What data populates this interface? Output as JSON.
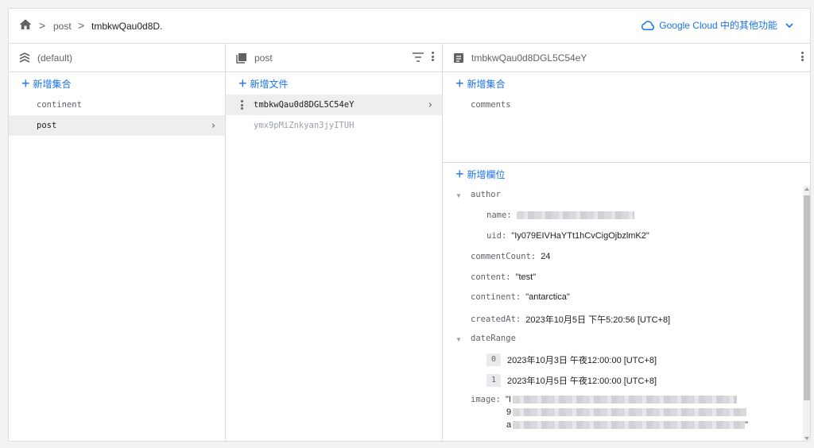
{
  "breadcrumb": {
    "items": [
      "post",
      "tmbkwQau0d8D."
    ],
    "separator": ">"
  },
  "gcloud": {
    "label": "Google Cloud 中的其他功能"
  },
  "columns": {
    "root": {
      "title": "(default)",
      "add_label": "新增集合",
      "items": [
        "continent",
        "post"
      ],
      "selected": "post"
    },
    "collection": {
      "title": "post",
      "add_label": "新增文件",
      "docs": [
        "tmbkwQau0d8DGL5C54eY",
        "ymx9pMiZnkyan3jyITUH"
      ]
    },
    "document": {
      "title": "tmbkwQau0d8DGL5C54eY",
      "add_collection_label": "新增集合",
      "subcollections": [
        "comments"
      ],
      "add_field_label": "新增欄位",
      "fields": {
        "author_key": "author",
        "name_key": "name:",
        "uid_key": "uid:",
        "uid_val": "\"Iy079EIVHaYTt1hCvCigOjbzlmK2\"",
        "commentCount_key": "commentCount:",
        "commentCount_val": "24",
        "content_key": "content:",
        "content_val": "\"test\"",
        "continent_key": "continent:",
        "continent_val": "\"antarctica\"",
        "createdAt_key": "createdAt:",
        "createdAt_val": "2023年10月5日 下午5:20:56 [UTC+8]",
        "dateRange_key": "dateRange",
        "dateRange": [
          {
            "index": "0",
            "value": "2023年10月3日 午夜12:00:00 [UTC+8]"
          },
          {
            "index": "1",
            "value": "2023年10月5日 午夜12:00:00 [UTC+8]"
          }
        ],
        "image_key": "image:",
        "image_line1": "\"I",
        "image_line2": "9",
        "image_line3": "a",
        "image_end": "\""
      }
    }
  },
  "colors": {
    "accent": "#1a73e8",
    "muted": "#5f6368",
    "selected_bg": "#eeeeee"
  }
}
